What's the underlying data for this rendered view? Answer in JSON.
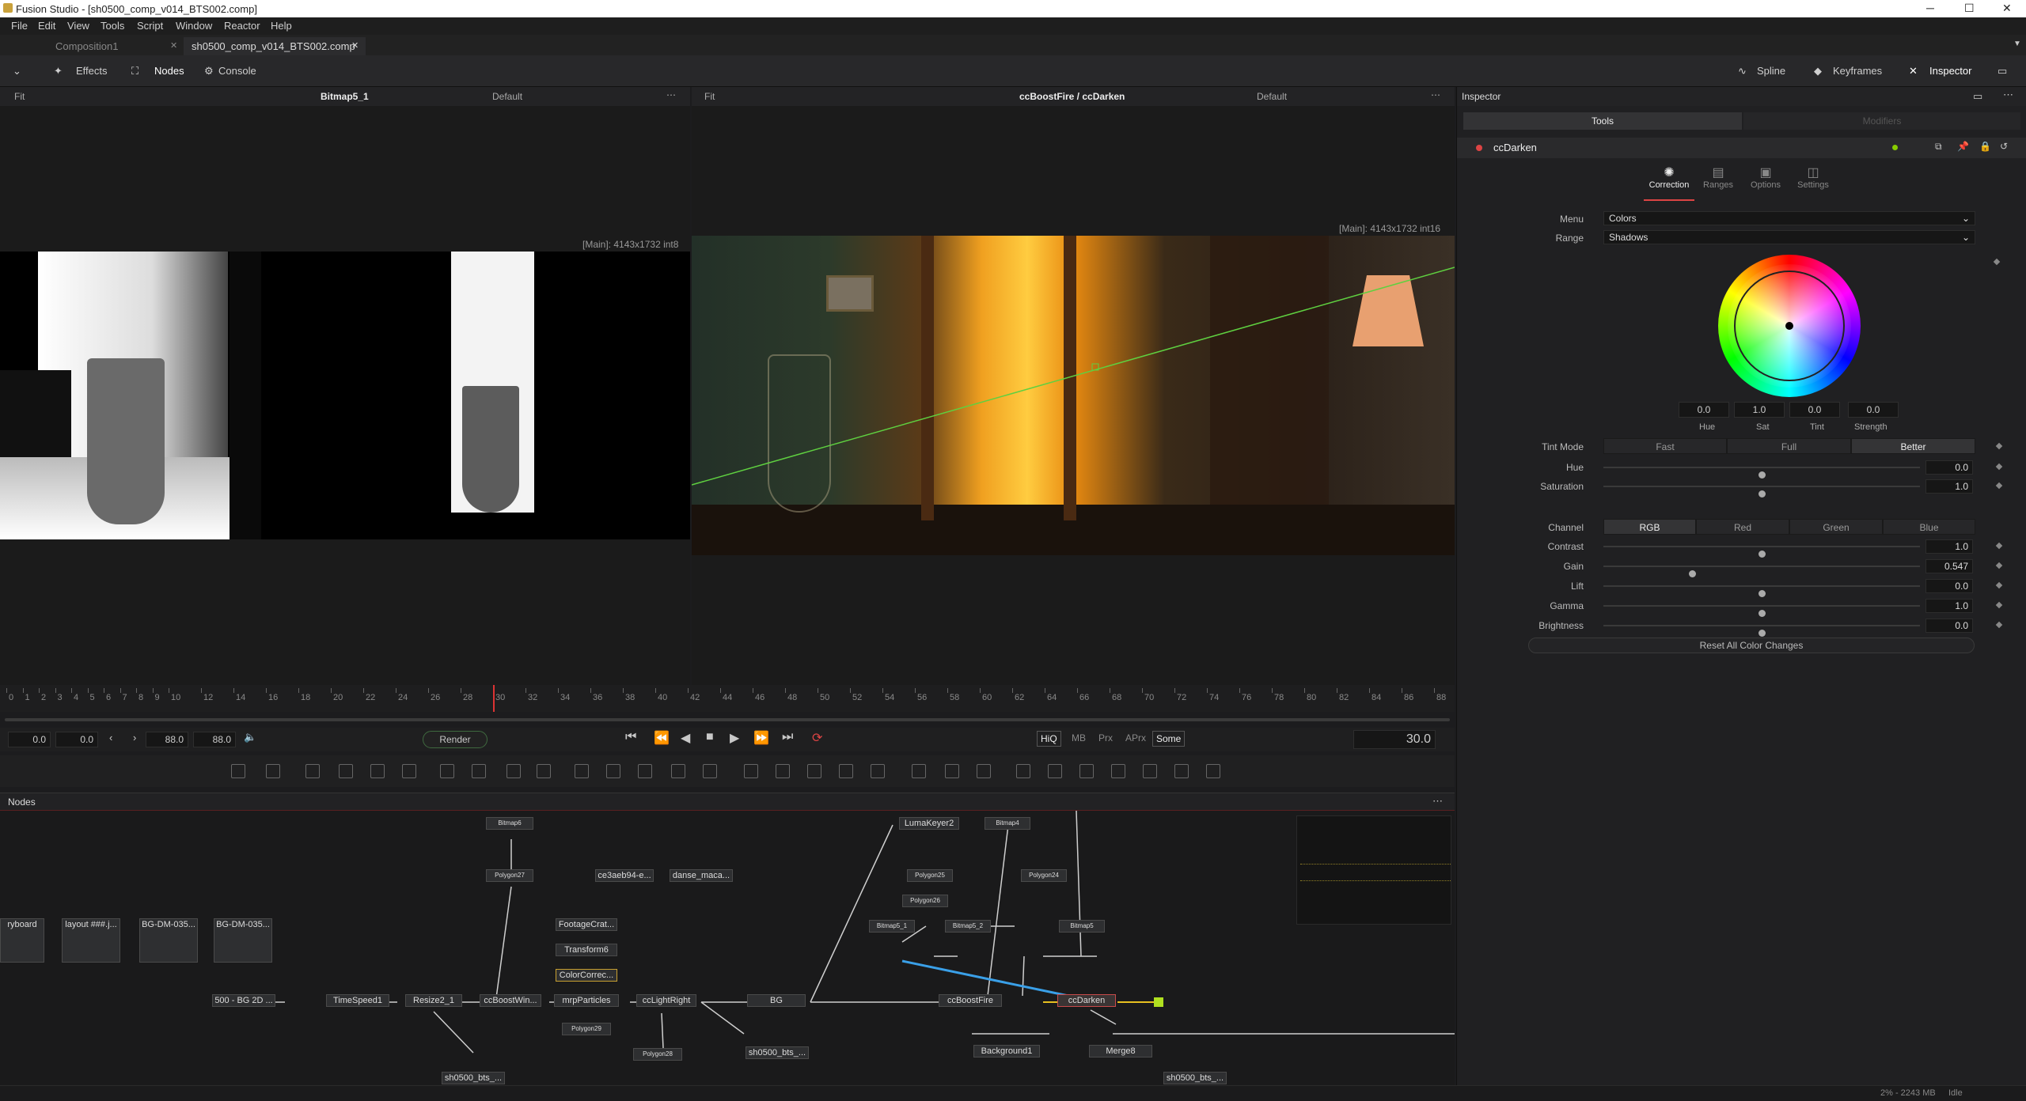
{
  "window": {
    "title": "Fusion Studio - [sh0500_comp_v014_BTS002.comp]"
  },
  "menu": [
    "File",
    "Edit",
    "View",
    "Tools",
    "Script",
    "Window",
    "Reactor",
    "Help"
  ],
  "tabs": [
    {
      "label": "Composition1"
    },
    {
      "label": "sh0500_comp_v014_BTS002.comp"
    }
  ],
  "toolbar": {
    "effects": "Effects",
    "nodes": "Nodes",
    "console": "Console",
    "spline": "Spline",
    "keyframes": "Keyframes",
    "inspector": "Inspector"
  },
  "viewer_left": {
    "fit": "Fit",
    "name": "Bitmap5_1",
    "lut": "Default",
    "info": "[Main]: 4143x1732 int8"
  },
  "viewer_right": {
    "fit": "Fit",
    "name": "ccBoostFire / ccDarken",
    "lut": "Default",
    "info": "[Main]: 4143x1732 int16"
  },
  "timeline": {
    "ticks": [
      "0",
      "1",
      "2",
      "3",
      "4",
      "5",
      "6",
      "7",
      "8",
      "9",
      "10",
      "12",
      "14",
      "16",
      "18",
      "20",
      "22",
      "24",
      "26",
      "28",
      "30",
      "32",
      "34",
      "36",
      "38",
      "40",
      "42",
      "44",
      "46",
      "48",
      "50",
      "52",
      "54",
      "56",
      "58",
      "60",
      "62",
      "64",
      "66",
      "68",
      "70",
      "72",
      "74",
      "76",
      "78",
      "80",
      "82",
      "84",
      "86",
      "88"
    ],
    "current": 30
  },
  "transport": {
    "start": "0.0",
    "render_start": "0.0",
    "render_end": "88.0",
    "end": "88.0",
    "render": "Render",
    "hiq": "HiQ",
    "mb": "MB",
    "prx": "Prx",
    "aprx": "APrx",
    "some": "Some",
    "frame": "30.0"
  },
  "nodes_panel": {
    "title": "Nodes"
  },
  "node_labels": {
    "bitmap6": "Bitmap6",
    "polygon27": "Polygon27",
    "ce3aeb": "ce3aeb94-e...",
    "danse": "danse_maca...",
    "storyboard": "ryboard",
    "layout": "layout ###.j...",
    "bgdm1": "BG-DM-035...",
    "bgdm2": "BG-DM-035...",
    "footage": "FootageCrat...",
    "transform6": "Transform6",
    "colorcorr": "ColorCorrec...",
    "bg2d": "500 - BG 2D ...",
    "timespeed": "TimeSpeed1",
    "resize": "Resize2_1",
    "ccboostwin": "ccBoostWin...",
    "mrparticles": "mrpParticles",
    "cclightright": "ccLightRight",
    "bg": "BG",
    "ccboostfire": "ccBoostFire",
    "ccdarken": "ccDarken",
    "polygon29": "Polygon29",
    "polygon28": "Polygon28",
    "sh0500a": "sh0500_bts_...",
    "sh0500b": "sh0500_bts_...",
    "sh0500c": "sh0500_bts_...",
    "lumakeyer": "LumaKeyer2",
    "bitmap4": "Bitmap4",
    "polygon25": "Polygon25",
    "polygon24": "Polygon24",
    "polygon26": "Polygon26",
    "bitmap51": "Bitmap5_1",
    "bitmap52": "Bitmap5_2",
    "bitmap5": "Bitmap5",
    "background": "Background1",
    "merge8": "Merge8"
  },
  "inspector": {
    "title": "Inspector",
    "tools_tab": "Tools",
    "modifiers_tab": "Modifiers",
    "node": "ccDarken",
    "subtabs": [
      "Correction",
      "Ranges",
      "Options",
      "Settings"
    ],
    "menu_label": "Menu",
    "menu_value": "Colors",
    "range_label": "Range",
    "range_value": "Shadows",
    "wheel": {
      "hue": "0.0",
      "sat": "1.0",
      "tint": "0.0",
      "strength": "0.0",
      "hue_l": "Hue",
      "sat_l": "Sat",
      "tint_l": "Tint",
      "strength_l": "Strength"
    },
    "tint_mode": {
      "label": "Tint Mode",
      "options": [
        "Fast",
        "Full",
        "Better"
      ],
      "selected": "Better"
    },
    "hue": {
      "label": "Hue",
      "value": "0.0",
      "pos": 0.5
    },
    "saturation": {
      "label": "Saturation",
      "value": "1.0",
      "pos": 0.5
    },
    "channel": {
      "label": "Channel",
      "options": [
        "RGB",
        "Red",
        "Green",
        "Blue"
      ],
      "selected": "RGB"
    },
    "contrast": {
      "label": "Contrast",
      "value": "1.0",
      "pos": 0.5
    },
    "gain": {
      "label": "Gain",
      "value": "0.547",
      "pos": 0.28
    },
    "lift": {
      "label": "Lift",
      "value": "0.0",
      "pos": 0.5
    },
    "gamma": {
      "label": "Gamma",
      "value": "1.0",
      "pos": 0.5
    },
    "brightness": {
      "label": "Brightness",
      "value": "0.0",
      "pos": 0.5
    },
    "reset": "Reset All Color Changes"
  },
  "status": {
    "mem": "2% - 2243 MB",
    "state": "Idle"
  }
}
